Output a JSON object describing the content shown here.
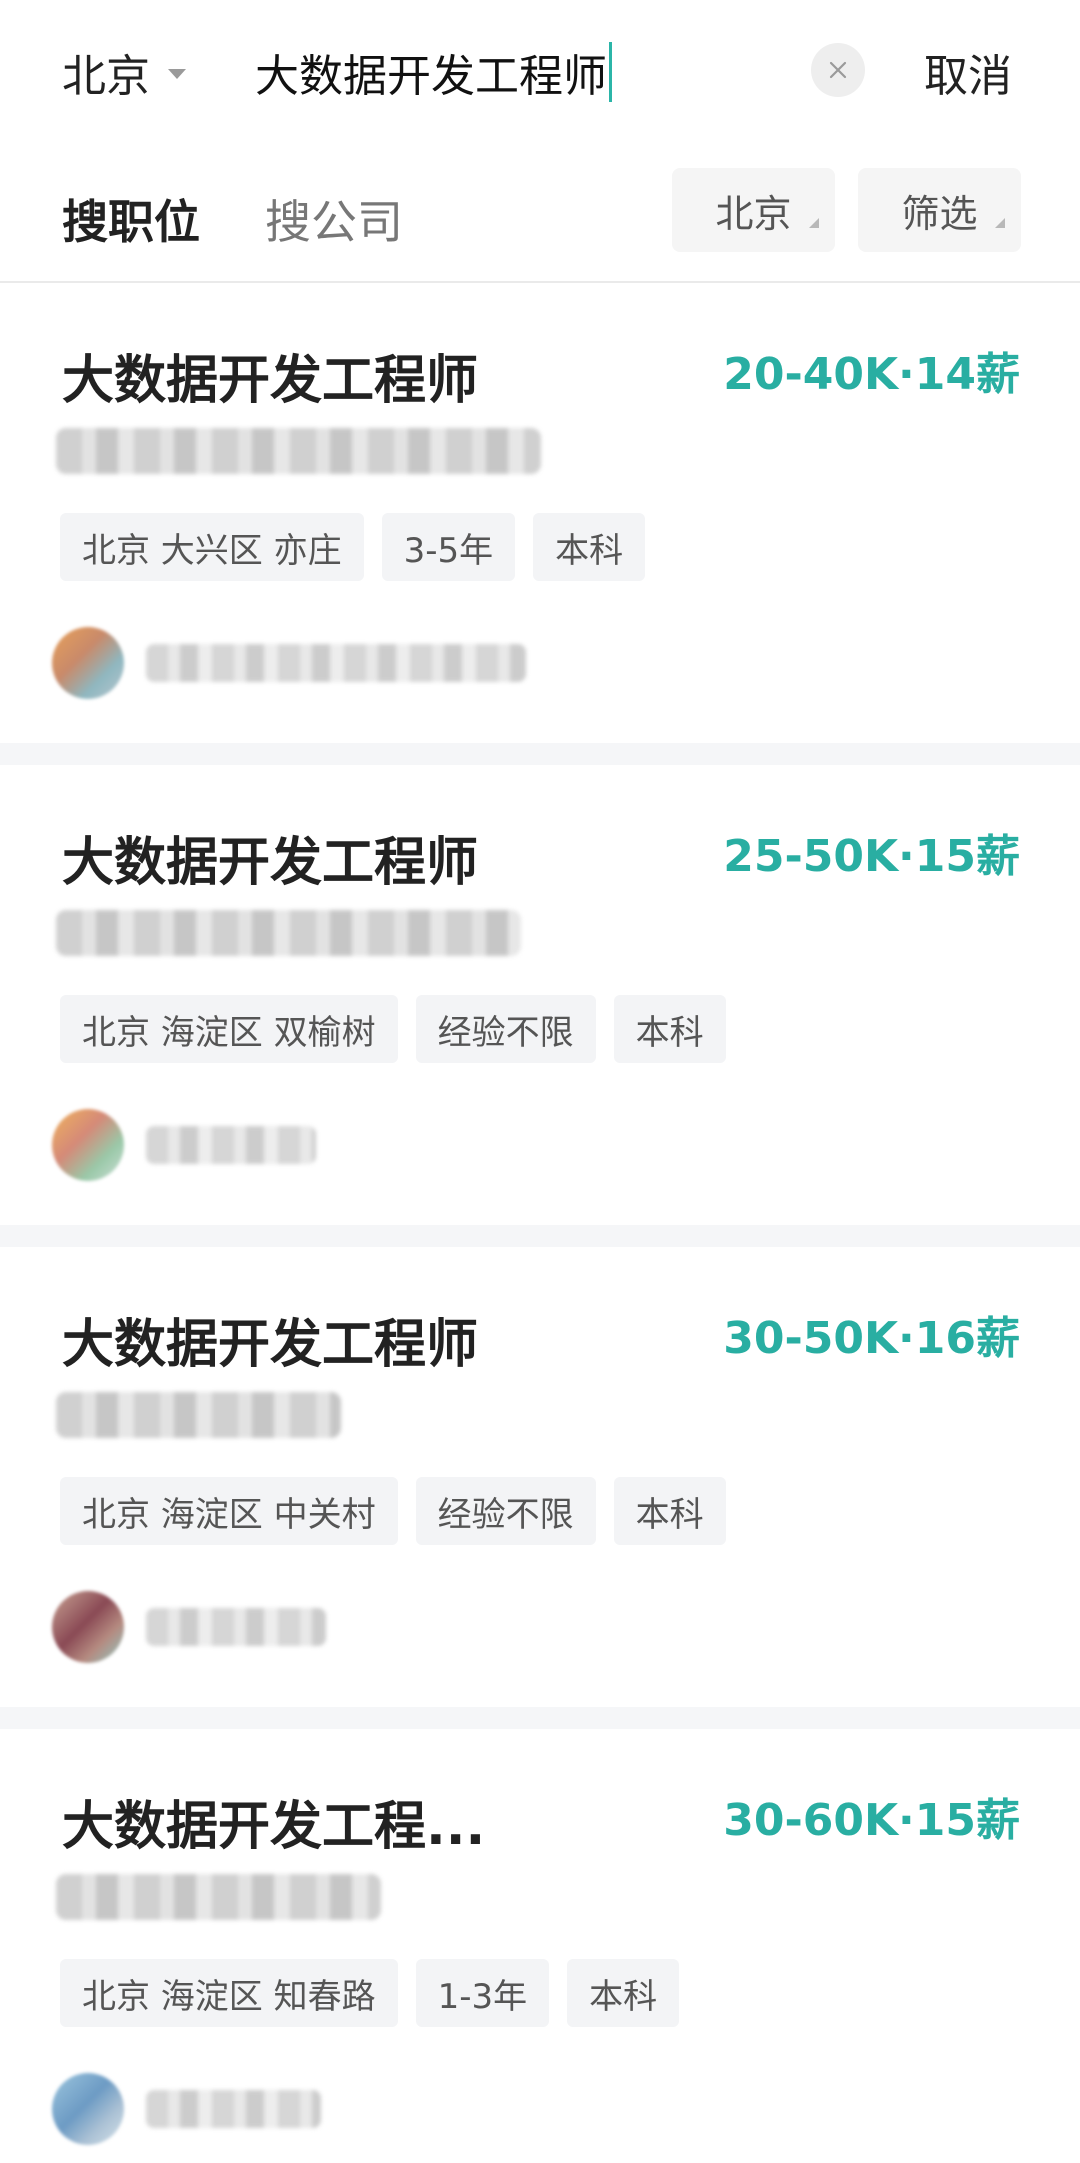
{
  "search": {
    "city": "北京",
    "query": "大数据开发工程师",
    "cancel_label": "取消"
  },
  "tabs": {
    "jobs": "搜职位",
    "companies": "搜公司"
  },
  "filters": {
    "city": "北京",
    "filter": "筛选"
  },
  "colors": {
    "accent": "#29aea2",
    "cursor": "#2bb5a8"
  },
  "jobs": [
    {
      "title": "大数据开发工程师",
      "salary": "20-40K·14薪",
      "tags": [
        "北京 大兴区 亦庄",
        "3-5年",
        "本科"
      ]
    },
    {
      "title": "大数据开发工程师",
      "salary": "25-50K·15薪",
      "tags": [
        "北京 海淀区 双榆树",
        "经验不限",
        "本科"
      ]
    },
    {
      "title": "大数据开发工程师",
      "salary": "30-50K·16薪",
      "tags": [
        "北京 海淀区 中关村",
        "经验不限",
        "本科"
      ]
    },
    {
      "title": "大数据开发工程...",
      "salary": "30-60K·15薪",
      "tags": [
        "北京 海淀区 知春路",
        "1-3年",
        "本科"
      ]
    }
  ]
}
